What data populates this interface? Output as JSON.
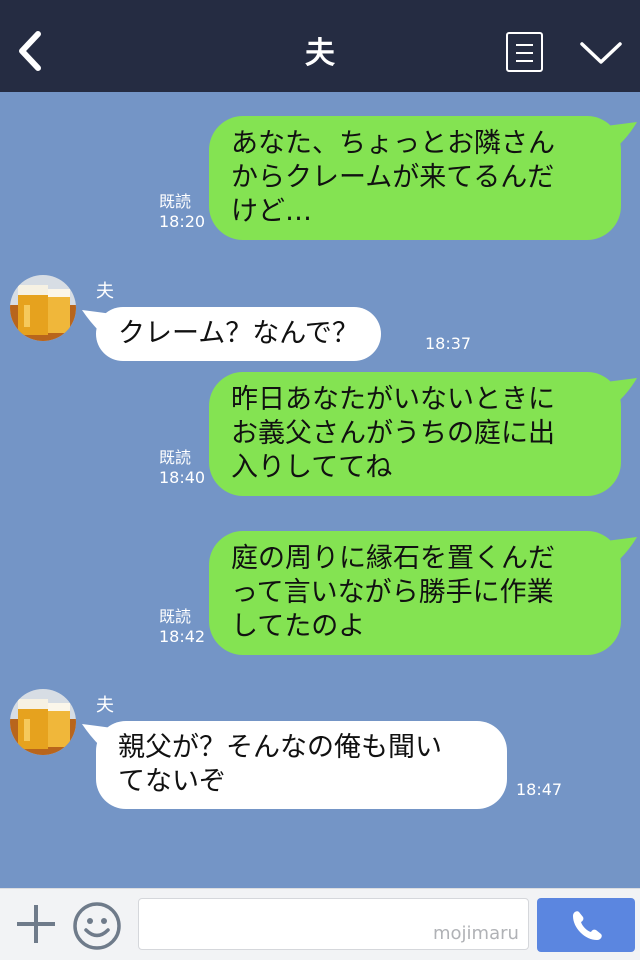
{
  "header": {
    "title": "夫"
  },
  "messages": [
    {
      "text": "あなた、ちょっとお隣さん\nからクレームが来てるんだ\nけど…",
      "read": "既読",
      "time": "18:20"
    },
    {
      "sender": "夫",
      "text": "クレーム？なんで？",
      "time": "18:37"
    },
    {
      "text": "昨日あなたがいないときに\nお義父さんがうちの庭に出\n入りしててね",
      "read": "既読",
      "time": "18:40"
    },
    {
      "text": "庭の周りに縁石を置くんだ\nって言いながら勝手に作業\nしてたのよ",
      "read": "既読",
      "time": "18:42"
    },
    {
      "sender": "夫",
      "text": "親父が？そんなの俺も聞い\nてないぞ",
      "time": "18:47"
    }
  ],
  "input": {
    "placeholder": "",
    "watermark": "mojimaru"
  },
  "colors": {
    "background": "#7495c6",
    "header": "#252c42",
    "outgoing_bubble": "#84e352",
    "incoming_bubble": "#ffffff",
    "call_button": "#5b86e0"
  },
  "icons": {
    "back": "chevron-left-icon",
    "menu": "document-icon",
    "collapse": "chevron-down-icon",
    "add": "plus-icon",
    "emoji": "smiley-icon",
    "call": "phone-icon"
  }
}
